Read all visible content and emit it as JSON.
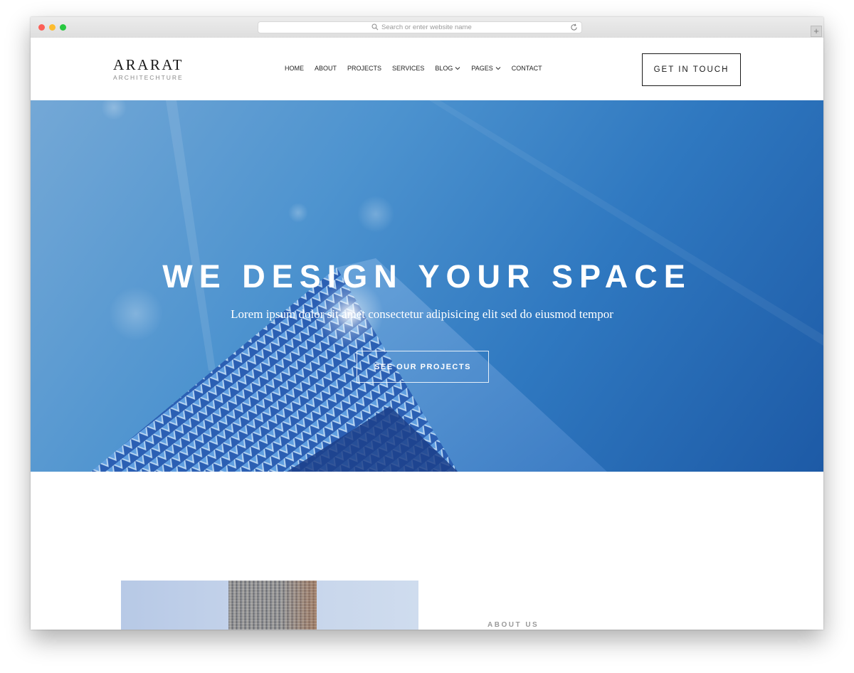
{
  "browser": {
    "url_placeholder": "Search or enter website name",
    "new_tab_symbol": "+"
  },
  "brand": {
    "name": "ARARAT",
    "tagline": "ARCHITECHTURE"
  },
  "nav": {
    "items": [
      {
        "label": "HOME",
        "dropdown": false
      },
      {
        "label": "ABOUT",
        "dropdown": false
      },
      {
        "label": "PROJECTS",
        "dropdown": false
      },
      {
        "label": "SERVICES",
        "dropdown": false
      },
      {
        "label": "BLOG",
        "dropdown": true
      },
      {
        "label": "PAGES",
        "dropdown": true
      },
      {
        "label": "CONTACT",
        "dropdown": false
      }
    ],
    "cta_label": "GET IN TOUCH"
  },
  "hero": {
    "title": "WE DESIGN YOUR SPACE",
    "subtitle": "Lorem ipsum dolor sit amet consectetur adipisicing elit sed do eiusmod tempor",
    "button_label": "SEE OUR PROJECTS"
  },
  "about": {
    "label": "ABOUT US"
  },
  "colors": {
    "hero_blue": "#2f78c0",
    "text_dark": "#1a1a1a",
    "muted": "#9a9a9a"
  },
  "icons": {
    "url_search": "search-icon",
    "url_reload": "reload-icon",
    "dropdown": "chevron-down-icon"
  }
}
